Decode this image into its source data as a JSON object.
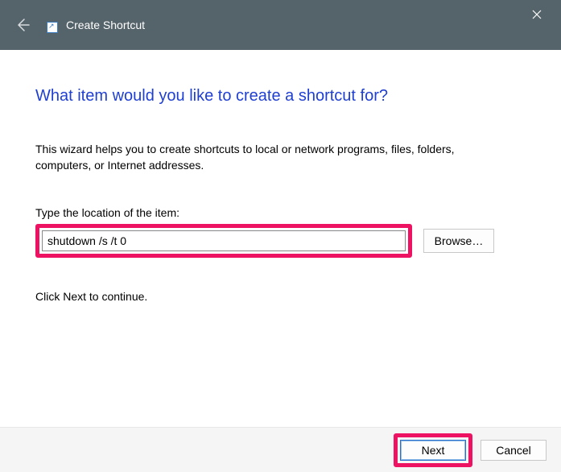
{
  "window": {
    "title": "Create Shortcut"
  },
  "page": {
    "heading": "What item would you like to create a shortcut for?",
    "description": "This wizard helps you to create shortcuts to local or network programs, files, folders, computers, or Internet addresses.",
    "field_label": "Type the location of the item:",
    "location_value": "shutdown /s /t 0",
    "browse_label": "Browse…",
    "continue_text": "Click Next to continue."
  },
  "footer": {
    "next_label": "Next",
    "cancel_label": "Cancel"
  },
  "colors": {
    "highlight": "#ed1362",
    "heading": "#1f3fd1",
    "titlebar": "#55636b"
  }
}
